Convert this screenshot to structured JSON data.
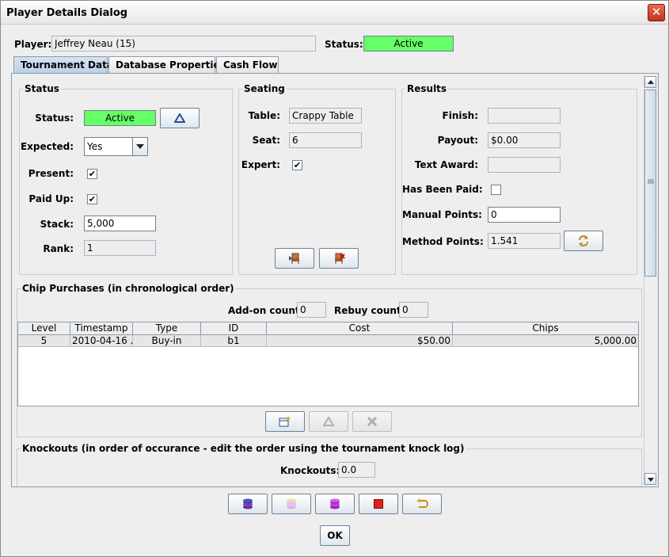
{
  "window": {
    "title": "Player Details Dialog"
  },
  "header": {
    "player_label": "Player:",
    "player_value": "Jeffrey Neau (15)",
    "status_label": "Status:",
    "status_value": "Active"
  },
  "tabs": [
    {
      "label": "Tournament Data",
      "active": true
    },
    {
      "label": "Database Properties",
      "active": false
    },
    {
      "label": "Cash Flow",
      "active": false
    }
  ],
  "status_group": {
    "title": "Status",
    "status_label": "Status:",
    "status_value": "Active",
    "expected_label": "Expected:",
    "expected_value": "Yes",
    "present_label": "Present:",
    "present_checked": "✔",
    "paid_up_label": "Paid Up:",
    "paid_up_checked": "✔",
    "stack_label": "Stack:",
    "stack_value": "5,000",
    "rank_label": "Rank:",
    "rank_value": "1"
  },
  "seating_group": {
    "title": "Seating",
    "table_label": "Table:",
    "table_value": "Crappy Table",
    "seat_label": "Seat:",
    "seat_value": "6",
    "expert_label": "Expert:",
    "expert_checked": "✔"
  },
  "results_group": {
    "title": "Results",
    "finish_label": "Finish:",
    "finish_value": "",
    "payout_label": "Payout:",
    "payout_value": "$0.00",
    "text_award_label": "Text Award:",
    "text_award_value": "",
    "has_been_paid_label": "Has Been Paid:",
    "manual_points_label": "Manual Points:",
    "manual_points_value": "0",
    "method_points_label": "Method Points:",
    "method_points_value": "1.541"
  },
  "chip_purchases": {
    "title": "Chip Purchases (in chronological order)",
    "addon_count_label": "Add-on count:",
    "addon_count_value": "0",
    "rebuy_count_label": "Rebuy count:",
    "rebuy_count_value": "0",
    "columns": [
      "Level",
      "Timestamp",
      "Type",
      "ID",
      "Cost",
      "Chips"
    ],
    "rows": [
      {
        "level": "5",
        "timestamp": "2010-04-16 ...",
        "type": "Buy-in",
        "id": "b1",
        "cost": "$50.00",
        "chips": "5,000.00"
      }
    ]
  },
  "knockouts": {
    "title": "Knockouts (in order of occurance - edit the order using the tournament knock log)",
    "knockouts_label": "Knockouts:",
    "knockouts_value": "0.0"
  },
  "footer": {
    "ok_label": "OK"
  },
  "colors": {
    "active_green": "#66ff66",
    "tab_active": "#c6daf0",
    "border": "#8e9aa8"
  }
}
